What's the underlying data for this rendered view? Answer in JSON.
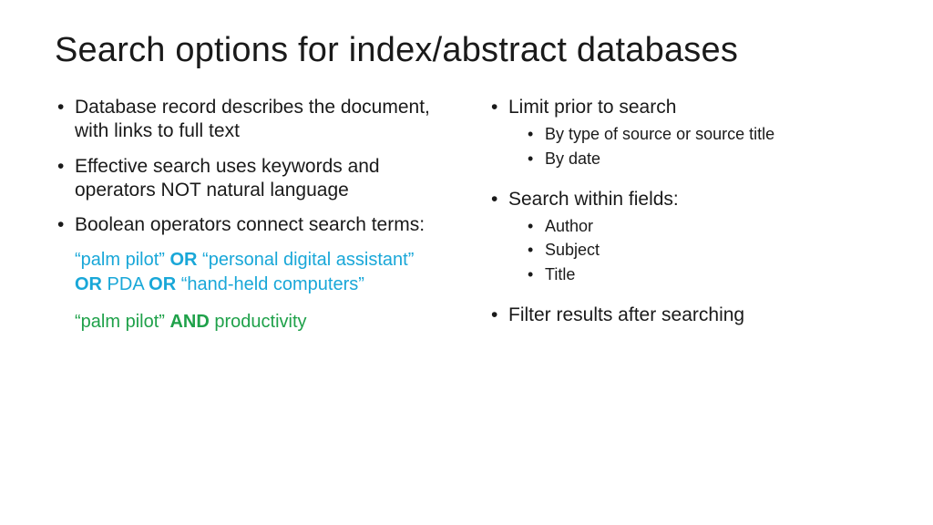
{
  "title": "Search options for index/abstract databases",
  "left": {
    "b1": "Database record describes the document, with links to full text",
    "b2": "Effective search uses keywords and operators NOT natural language",
    "b3": "Boolean operators connect search terms:",
    "ex_or": {
      "t1": "“palm pilot” ",
      "op1": "OR",
      "t2": " “personal digital assistant” ",
      "op2": "OR",
      "t3": " PDA ",
      "op3": "OR",
      "t4": " “hand-held computers”"
    },
    "ex_and": {
      "t1": "“palm pilot” ",
      "op1": "AND",
      "t2": " productivity"
    }
  },
  "right": {
    "b1": "Limit prior to search",
    "b1_sub": {
      "s1": "By type of source or source title",
      "s2": "By date"
    },
    "b2": "Search within fields:",
    "b2_sub": {
      "s1": "Author",
      "s2": "Subject",
      "s3": "Title"
    },
    "b3": "Filter results after searching"
  }
}
